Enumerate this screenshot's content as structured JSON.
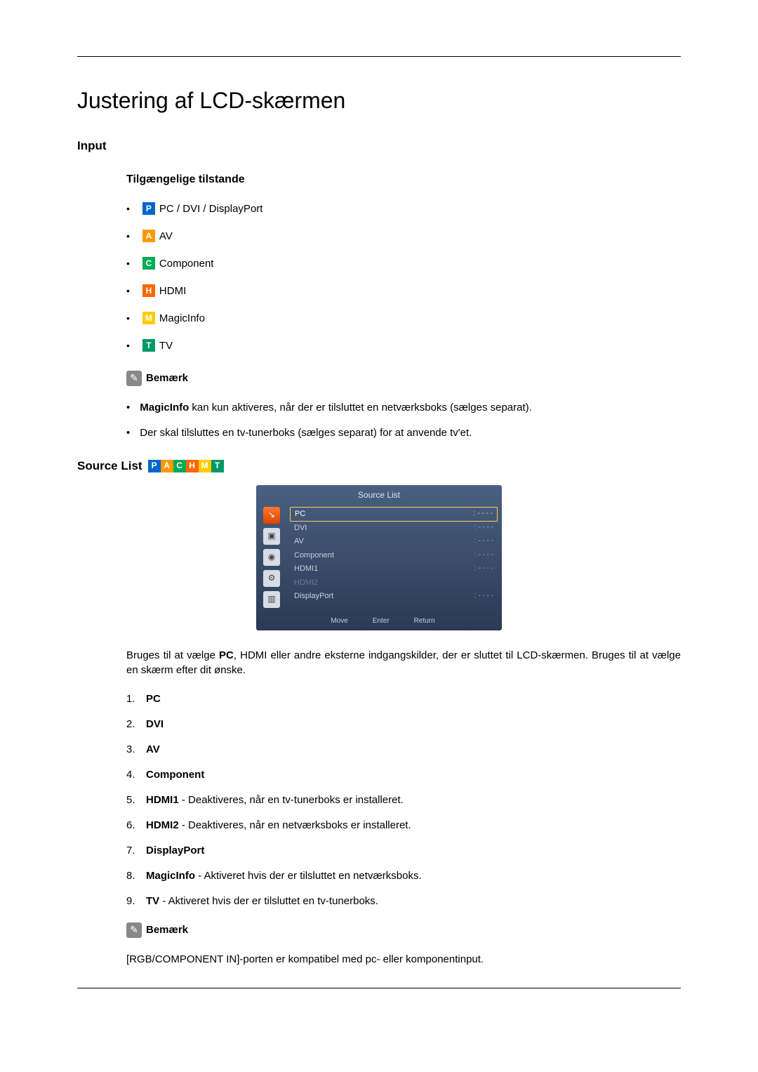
{
  "page_title": "Justering af LCD-skærmen",
  "section_input": "Input",
  "modes_heading": "Tilgængelige tilstande",
  "modes": {
    "pc": "PC / DVI / DisplayPort",
    "av": "AV",
    "component": "Component",
    "hdmi": "HDMI",
    "magicinfo": "MagicInfo",
    "tv": "TV"
  },
  "icon_letters": {
    "p": "P",
    "a": "A",
    "c": "C",
    "h": "H",
    "m": "M",
    "t": "T"
  },
  "note_label": "Bemærk",
  "notes": {
    "n1a": "MagicInfo",
    "n1b": " kan kun aktiveres, når der er tilsluttet en netværksboks (sælges separat).",
    "n2": "Der skal tilsluttes en tv-tunerboks (sælges separat) for at anvende tv'et."
  },
  "source_list_title": "Source List",
  "osd": {
    "title": "Source List",
    "rows": {
      "pc": "PC",
      "dvi": "DVI",
      "av": "AV",
      "component": "Component",
      "hdmi1": "HDMI1",
      "hdmi2": "HDMI2",
      "displayport": "DisplayPort"
    },
    "val_active": ": - - - -",
    "val_dash": ": - - - -",
    "footer": {
      "move": "Move",
      "enter": "Enter",
      "return": "Return"
    }
  },
  "desc": {
    "p1a": "Bruges til at vælge ",
    "p1b": "PC",
    "p1c": ", HDMI eller andre eksterne indgangskilder, der er sluttet til LCD-skærmen. Bruges til at vælge en skærm efter dit ønske."
  },
  "list": {
    "i1": "PC",
    "i2": "DVI",
    "i3": "AV",
    "i4": "Component",
    "i5a": "HDMI1",
    "i5b": " - Deaktiveres, når en tv-tunerboks er installeret.",
    "i6a": "HDMI2",
    "i6b": " - Deaktiveres, når en netværksboks er installeret.",
    "i7": "DisplayPort",
    "i8a": "MagicInfo",
    "i8b": " - Aktiveret hvis der er tilsluttet en netværksboks.",
    "i9a": "TV",
    "i9b": " - Aktiveret hvis der er tilsluttet en tv-tunerboks."
  },
  "bottom_note": "[RGB/COMPONENT IN]-porten er kompatibel med pc- eller komponentinput."
}
